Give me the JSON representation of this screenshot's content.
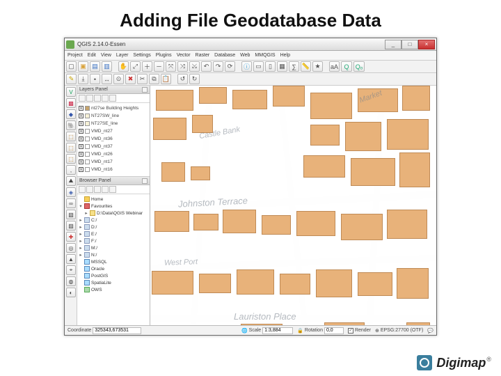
{
  "slide": {
    "title": "Adding File Geodatabase Data"
  },
  "window": {
    "title": "QGIS 2.14.0-Essen",
    "min": "_",
    "max": "□",
    "close": "×"
  },
  "menus": [
    "Project",
    "Edit",
    "View",
    "Layer",
    "Settings",
    "Plugins",
    "Vector",
    "Raster",
    "Database",
    "Web",
    "MMQGIS",
    "Help"
  ],
  "panels": {
    "layers_title": "Layers Panel",
    "browser_title": "Browser Panel"
  },
  "layers": [
    {
      "name": "nt27se Building Heights",
      "swatch": "#c7a46d"
    },
    {
      "name": "NT27SW_line",
      "swatch": "#f6f1d7"
    },
    {
      "name": "NT27SE_line",
      "swatch": "#f6f1d7"
    },
    {
      "name": "VMD_nt27",
      "swatch": "#ffffff"
    },
    {
      "name": "VMD_nt36",
      "swatch": "#ffffff"
    },
    {
      "name": "VMD_nt37",
      "swatch": "#ffffff"
    },
    {
      "name": "VMD_nt26",
      "swatch": "#ffffff"
    },
    {
      "name": "VMD_nt17",
      "swatch": "#ffffff"
    },
    {
      "name": "VMD_nt16",
      "swatch": "#ffffff"
    }
  ],
  "browser": [
    {
      "icon": "home",
      "tw": "",
      "label": "Home",
      "indent": 0
    },
    {
      "icon": "fav",
      "tw": "▾",
      "label": "Favourites",
      "indent": 0
    },
    {
      "icon": "fld",
      "tw": "▸",
      "label": "D:\\Data\\QGIS Webinar",
      "indent": 1
    },
    {
      "icon": "drv",
      "tw": "▸",
      "label": "C:/",
      "indent": 0
    },
    {
      "icon": "drv",
      "tw": "▸",
      "label": "D:/",
      "indent": 0
    },
    {
      "icon": "drv",
      "tw": "▸",
      "label": "E:/",
      "indent": 0
    },
    {
      "icon": "drv",
      "tw": "▸",
      "label": "F:/",
      "indent": 0
    },
    {
      "icon": "drv",
      "tw": "▸",
      "label": "M:/",
      "indent": 0
    },
    {
      "icon": "drv",
      "tw": "▸",
      "label": "N:/",
      "indent": 0
    },
    {
      "icon": "db",
      "tw": "",
      "label": "MSSQL",
      "indent": 0
    },
    {
      "icon": "db",
      "tw": "",
      "label": "Oracle",
      "indent": 0
    },
    {
      "icon": "db",
      "tw": "",
      "label": "PostGIS",
      "indent": 0
    },
    {
      "icon": "db",
      "tw": "",
      "label": "SpatiaLite",
      "indent": 0
    },
    {
      "icon": "ows",
      "tw": "",
      "label": "OWS",
      "indent": 0
    }
  ],
  "status": {
    "coord_label": "Coordinate",
    "coord_value": "325343,673531",
    "scale_label": "Scale",
    "scale_value": "1:3,884",
    "rot_label": "Rotation",
    "rot_value": "0,0",
    "render_label": "Render",
    "crs_label": "EPSG:27700 (OTF)"
  },
  "map_labels": {
    "castle": "Castle Bank",
    "market": "Market",
    "johnston": "Johnston Terrace",
    "port": "West Port",
    "lauriston": "Lauriston Place"
  },
  "brand": {
    "name": "Digimap",
    "reg": "®"
  }
}
